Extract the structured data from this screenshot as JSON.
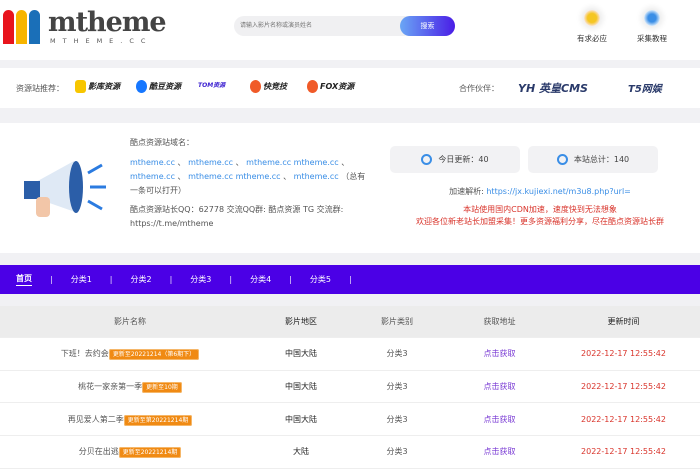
{
  "header": {
    "logo_text": "mtheme",
    "logo_sub": "MTHEME.CC",
    "logo_colors": [
      "#e8141c",
      "#f7b500",
      "#1a6fb8"
    ],
    "search_placeholder": "请输入影片名称或演员姓名",
    "search_button": "搜索",
    "links": [
      {
        "label": "有求必应",
        "icon": "lightbulb-icon",
        "color": "#f5a623"
      },
      {
        "label": "采集教程",
        "icon": "location-icon",
        "color": "#3a8ee6"
      }
    ]
  },
  "partners": {
    "label": "资源站推荐：",
    "items": [
      {
        "label": "影库资源",
        "color": "#f7c600"
      },
      {
        "label": "酷豆资源",
        "color": "#1677ff"
      },
      {
        "label": "TOM资源",
        "color": "#3a1fd0"
      },
      {
        "label": "快竞技",
        "color": "#f05a28"
      },
      {
        "label": "FOX资源",
        "color": "#f05a28"
      }
    ],
    "cooperation_label": "合作伙伴：",
    "cooperation": [
      "YH 英皇CMS",
      "T5网娱"
    ]
  },
  "info": {
    "domains_title": "酷点资源站域名：",
    "domains": [
      "mtheme.cc",
      "mtheme.cc",
      "mtheme.cc mtheme.cc",
      "mtheme.cc",
      "mtheme.cc mtheme.cc",
      "mtheme.cc"
    ],
    "domains_note": "（总有一条可以打开）",
    "contact": "酷点资源站长QQ：62778 交流QQ群: 酷点资源 TG 交流群: https://t.me/mtheme",
    "today_label": "今日更新：40",
    "total_label": "本站总计：140",
    "parse_label": "加速解析:",
    "parse_url": "https://jx.kujiexi.net/m3u8.php?url=",
    "notice1": "本站使用国内CDN加速，速度快到无法想象",
    "notice2": "欢迎各位新老站长加盟采集！更多资源福利分享，尽在酷点资源站长群"
  },
  "nav": {
    "items": [
      "首页",
      "分类1",
      "分类2",
      "分类3",
      "分类4",
      "分类5"
    ],
    "active": 0,
    "color": "#4b00e6"
  },
  "table": {
    "headers": [
      "影片名称",
      "影片地区",
      "影片类别",
      "获取地址",
      "更新时间"
    ],
    "rows": [
      {
        "name": "下班！去约会",
        "badge": "更新至20221214（第6期下）",
        "region": "中国大陆",
        "category": "分类3",
        "link": "点击获取",
        "time": "2022-12-17 12:55:42"
      },
      {
        "name": "桃花一家亲第一季",
        "badge": "更新至10期",
        "region": "中国大陆",
        "category": "分类3",
        "link": "点击获取",
        "time": "2022-12-17 12:55:42"
      },
      {
        "name": "再见爱人第二季",
        "badge": "更新至第20221214期",
        "region": "中国大陆",
        "category": "分类3",
        "link": "点击获取",
        "time": "2022-12-17 12:55:42"
      },
      {
        "name": "分贝在出逃",
        "badge": "更新至20221214期",
        "region": "大陆",
        "category": "分类3",
        "link": "点击获取",
        "time": "2022-12-17 12:55:42"
      }
    ]
  }
}
